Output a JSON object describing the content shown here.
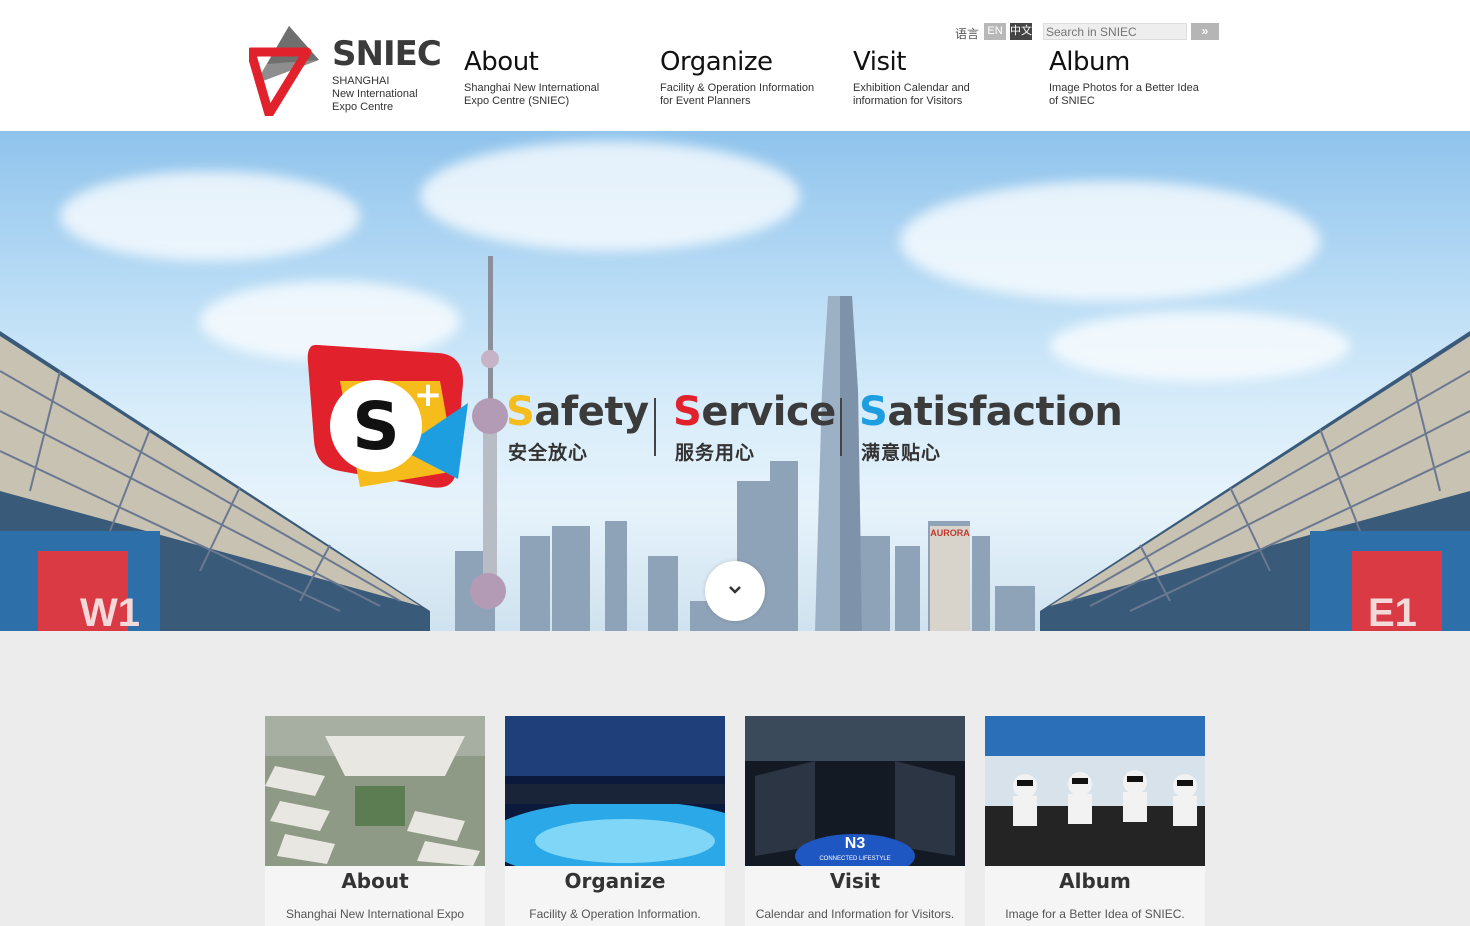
{
  "header": {
    "logo": {
      "wordmark": "SNIEC",
      "sub_line1": "SHANGHAI",
      "sub_line2": "New International",
      "sub_line3": "Expo Centre"
    },
    "nav": [
      {
        "title": "About",
        "desc_line1": "Shanghai New International",
        "desc_line2": "Expo Centre (SNIEC)"
      },
      {
        "title": "Organize",
        "desc_line1": "Facility & Operation Information",
        "desc_line2": "for Event Planners"
      },
      {
        "title": "Visit",
        "desc_line1": "Exhibition Calendar and",
        "desc_line2": "information for Visitors"
      },
      {
        "title": "Album",
        "desc_line1": "Image Photos for a Better Idea",
        "desc_line2": "of SNIEC"
      }
    ],
    "lang_label": "语言",
    "lang_en": "EN",
    "lang_cn": "中文",
    "search_placeholder": "Search in SNIEC",
    "search_button": "»"
  },
  "hero": {
    "slogan1_cap": "S",
    "slogan1_rest": "afety",
    "slogan1_cn": "安全放心",
    "slogan2_cap": "S",
    "slogan2_rest": "ervice",
    "slogan2_cn": "服务用心",
    "slogan3_cap": "S",
    "slogan3_rest": "atisfaction",
    "slogan3_cn": "满意贴心",
    "hall_left": "W1",
    "hall_right": "E1",
    "building_sign": "AURORA",
    "colors": {
      "red": "#e1222c",
      "yellow": "#f6bc1b",
      "blue": "#1d9ee0",
      "dark": "#3b3b3b"
    }
  },
  "cards": [
    {
      "title": "About",
      "desc": "Shanghai New International Expo"
    },
    {
      "title": "Organize",
      "desc": "Facility & Operation Information."
    },
    {
      "title": "Visit",
      "desc": "Calendar and Information for Visitors."
    },
    {
      "title": "Album",
      "desc": "Image for a Better Idea of SNIEC."
    }
  ],
  "card_image_labels": {
    "visit_floor_sign": "N3",
    "visit_floor_sub": "CONNECTED LIFESTYLE"
  },
  "icons": [
    "logo-triangle-icon",
    "search-arrow-icon",
    "chevron-down-icon"
  ]
}
